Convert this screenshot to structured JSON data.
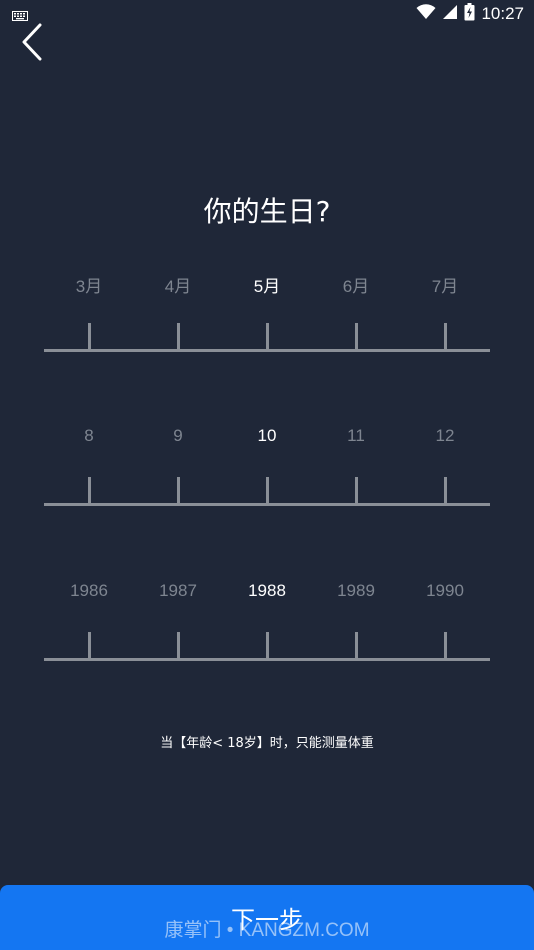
{
  "status_bar": {
    "time": "10:27",
    "icons": [
      "keyboard-icon",
      "wifi-icon",
      "signal-icon",
      "battery-charging-icon"
    ]
  },
  "header": {
    "back_icon": "chevron-left-icon"
  },
  "title": "你的生日?",
  "month_picker": {
    "labels": [
      "3月",
      "4月",
      "5月",
      "6月",
      "7月"
    ],
    "selected": "5月"
  },
  "day_picker": {
    "labels": [
      "8",
      "9",
      "10",
      "11",
      "12"
    ],
    "selected": "10"
  },
  "year_picker": {
    "labels": [
      "1986",
      "1987",
      "1988",
      "1989",
      "1990"
    ],
    "selected": "1988"
  },
  "note": "当【年龄< 18岁】时，只能测量体重",
  "next_button": {
    "label": "下一步",
    "color": "#1476f2"
  },
  "watermark": "康掌门 • KANGZM.COM",
  "colors": {
    "background": "#1f2738",
    "tick": "#8a8f97",
    "dim_label": "#7e8590",
    "active_label": "#ffffff"
  }
}
